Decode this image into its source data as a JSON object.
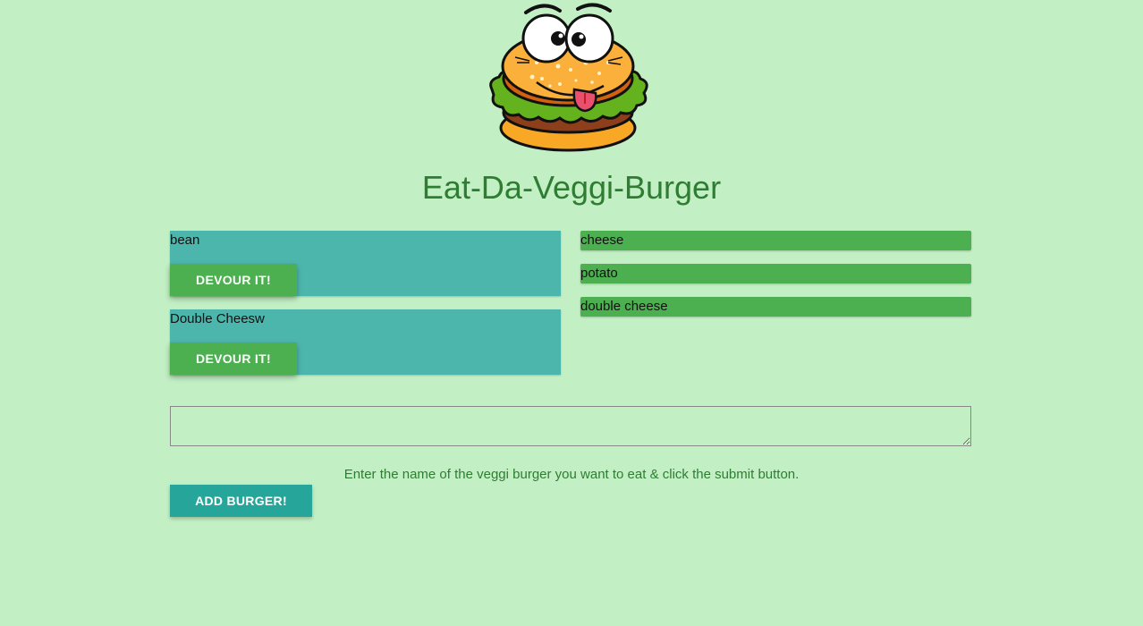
{
  "header": {
    "title": "Eat-Da-Veggi-Burger",
    "logo_icon": "cartoon-burger-mascot"
  },
  "uneaten_burgers": [
    {
      "name": "bean",
      "button_label": "DEVOUR IT!"
    },
    {
      "name": "Double Cheesw",
      "button_label": "DEVOUR IT!"
    }
  ],
  "devoured_burgers": [
    {
      "name": "cheese"
    },
    {
      "name": "potato"
    },
    {
      "name": "double cheese"
    }
  ],
  "form": {
    "input_value": "",
    "instructions": "Enter the name of the veggi burger you want to eat & click the submit button.",
    "submit_label": "ADD BURGER!"
  },
  "colors": {
    "background": "#c2f0c4",
    "title": "#2e7d32",
    "card": "#4db6ac",
    "devour_button": "#4caf50",
    "devoured_item": "#4caf50",
    "add_button": "#26a69a"
  }
}
